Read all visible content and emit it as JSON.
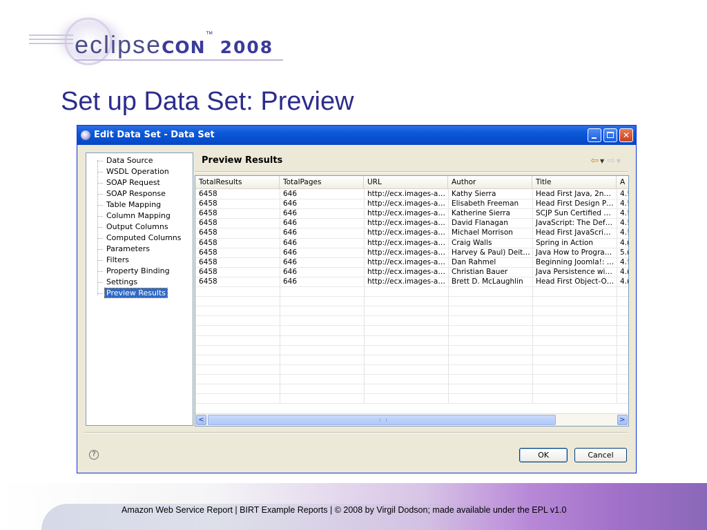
{
  "slide": {
    "logo": {
      "word": "eclipse",
      "con": "CON",
      "tm": "™",
      "year": "2008"
    },
    "title": "Set up Data Set: Preview",
    "footer": "Amazon Web Service Report  |  BIRT Example Reports |  © 2008 by Virgil Dodson; made available under the EPL v1.0"
  },
  "dialog": {
    "title": "Edit Data Set - Data Set",
    "nav_items": [
      "Data Source",
      "WSDL Operation",
      "SOAP Request",
      "SOAP Response",
      "Table Mapping",
      "Column Mapping",
      "Output Columns",
      "Computed Columns",
      "Parameters",
      "Filters",
      "Property Binding",
      "Settings",
      "Preview Results"
    ],
    "selected_nav": "Preview Results",
    "panel_title": "Preview Results",
    "columns": [
      "TotalResults",
      "TotalPages",
      "URL",
      "Author",
      "Title",
      "A"
    ],
    "rows": [
      [
        "6458",
        "646",
        "http://ecx.images-a…",
        "Kathy Sierra",
        "Head First Java, 2n…",
        "4.!"
      ],
      [
        "6458",
        "646",
        "http://ecx.images-a…",
        "Elisabeth Freeman",
        "Head First Design P…",
        "4.!"
      ],
      [
        "6458",
        "646",
        "http://ecx.images-a…",
        "Katherine Sierra",
        "SCJP Sun Certified …",
        "4.!"
      ],
      [
        "6458",
        "646",
        "http://ecx.images-a…",
        "David Flanagan",
        "JavaScript: The Def…",
        "4.!"
      ],
      [
        "6458",
        "646",
        "http://ecx.images-a…",
        "Michael Morrison",
        "Head First JavaScri…",
        "4.!"
      ],
      [
        "6458",
        "646",
        "http://ecx.images-a…",
        "Craig Walls",
        "Spring in Action",
        "4.("
      ],
      [
        "6458",
        "646",
        "http://ecx.images-a…",
        "Harvey & Paul) Deit…",
        "Java How to Progra…",
        "5.("
      ],
      [
        "6458",
        "646",
        "http://ecx.images-a…",
        "Dan Rahmel",
        "Beginning Joomla!: …",
        "4.!"
      ],
      [
        "6458",
        "646",
        "http://ecx.images-a…",
        "Christian Bauer",
        "Java Persistence wi…",
        "4.("
      ],
      [
        "6458",
        "646",
        "http://ecx.images-a…",
        "Brett D. McLaughlin",
        "Head First Object-O…",
        "4.("
      ]
    ],
    "buttons": {
      "ok": "OK",
      "cancel": "Cancel"
    },
    "icons": {
      "window": "eclipse-icon",
      "back": "back-arrow-icon",
      "forward": "forward-arrow-icon",
      "help": "help-icon",
      "minimize": "minimize-icon",
      "maximize": "maximize-icon",
      "close": "close-icon"
    },
    "colors": {
      "titlebar": "#0a57d8",
      "selection": "#316ac5"
    }
  }
}
